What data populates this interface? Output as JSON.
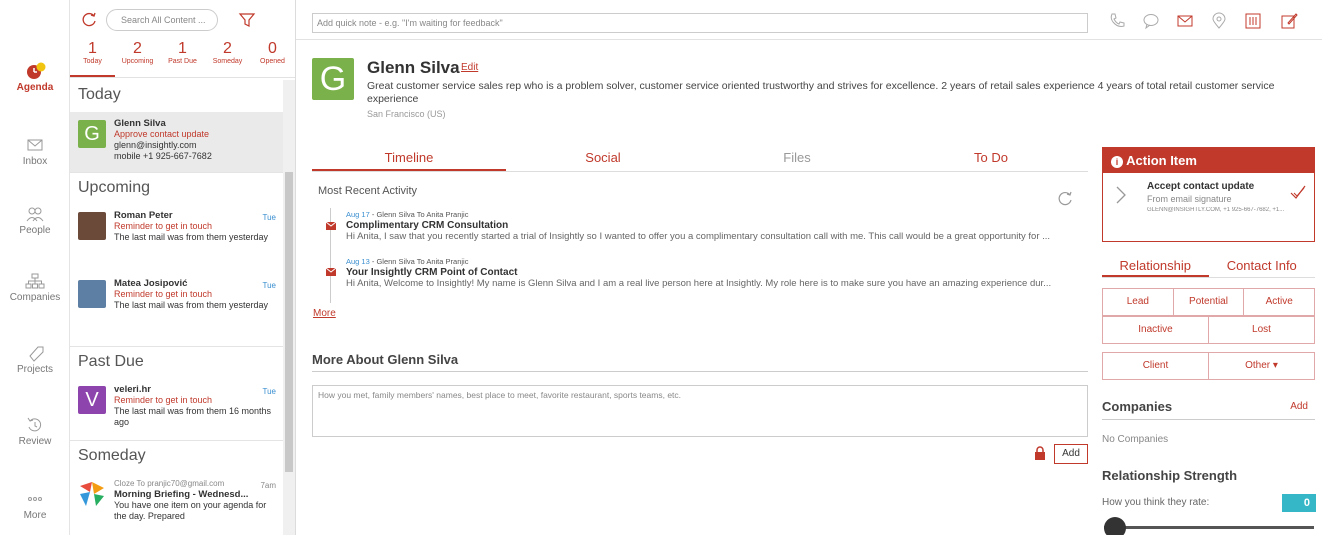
{
  "nav": {
    "items": [
      {
        "label": "Agenda",
        "badge": "1"
      },
      {
        "label": "Inbox"
      },
      {
        "label": "People"
      },
      {
        "label": "Companies"
      },
      {
        "label": "Projects"
      },
      {
        "label": "Review"
      },
      {
        "label": "More"
      }
    ]
  },
  "agenda": {
    "search_placeholder": "Search All Content ...",
    "counts": [
      {
        "n": "1",
        "label": "Today"
      },
      {
        "n": "2",
        "label": "Upcoming"
      },
      {
        "n": "1",
        "label": "Past Due"
      },
      {
        "n": "2",
        "label": "Someday"
      },
      {
        "n": "0",
        "label": "Opened"
      }
    ],
    "sections": {
      "today": "Today",
      "upcoming": "Upcoming",
      "pastdue": "Past Due",
      "someday": "Someday"
    },
    "today_item": {
      "avatar": "G",
      "name": "Glenn Silva",
      "action": "Approve contact update",
      "email": "glenn@insightly.com",
      "phone": "mobile +1 925-667-7682"
    },
    "upcoming_items": [
      {
        "name": "Roman Peter",
        "day": "Tue",
        "action": "Reminder to get in touch",
        "note": "The last mail was from them yesterday"
      },
      {
        "name": "Matea Josipović",
        "day": "Tue",
        "action": "Reminder to get in touch",
        "note": "The last mail was from them yesterday"
      }
    ],
    "pastdue_item": {
      "avatar": "V",
      "name": "veleri.hr",
      "day": "Tue",
      "action": "Reminder to get in touch",
      "note": "The last mail was from them 16 months ago"
    },
    "someday_item": {
      "meta": "Cloze To pranjic70@gmail.com",
      "time": "7am",
      "title": "Morning Briefing - Wednesd...",
      "note": "You have one item on your agenda for the day. Prepared"
    }
  },
  "topbar": {
    "note_placeholder": "Add quick note - e.g. \"I'm waiting for feedback\""
  },
  "contact": {
    "avatar": "G",
    "name": "Glenn Silva",
    "edit": "Edit",
    "description": "Great customer service sales rep who is a problem solver, customer service oriented trustworthy and strives for excellence. 2 years of retail sales experience 4 years of total retail customer service experience",
    "location": "San Francisco (US)"
  },
  "tabs": [
    "Timeline",
    "Social",
    "Files",
    "To Do"
  ],
  "timeline": {
    "heading": "Most Recent Activity",
    "activities": [
      {
        "date": "Aug 17",
        "meta": " - Glenn Silva  To Anita Pranjic",
        "title": "Complimentary CRM Consultation",
        "body": "Hi Anita, I saw that you recently started a trial of Insightly so I wanted to offer you a complimentary consultation call with me. This call would be a great opportunity for ..."
      },
      {
        "date": "Aug 13",
        "meta": " - Glenn Silva  To Anita Pranjic",
        "title": "Your Insightly CRM Point of Contact",
        "body": "Hi Anita, Welcome to Insightly!  My name is Glenn Silva and I am a real live person here at Insightly.  My role here is to make sure you have an amazing experience dur..."
      }
    ],
    "more": "More"
  },
  "more_about": {
    "heading": "More About Glenn Silva",
    "placeholder": "How you met, family members' names, best place to meet, favorite restaurant, sports teams, etc.",
    "add": "Add"
  },
  "action_item": {
    "header": "Action Item",
    "title": "Accept contact update",
    "subtitle": "From email signature",
    "detail": "GLENN@INSIGHTLY.COM, +1 925-667-7682, +1..."
  },
  "relationship": {
    "tabs": [
      "Relationship",
      "Contact Info"
    ],
    "stages_row1": [
      "Lead",
      "Potential",
      "Active"
    ],
    "stages_row2": [
      "Inactive",
      "Lost"
    ],
    "stages_row3": [
      "Client",
      "Other ▾"
    ]
  },
  "companies": {
    "heading": "Companies",
    "add": "Add",
    "empty": "No Companies"
  },
  "strength": {
    "heading": "Relationship Strength",
    "prompt": "How you think they rate:",
    "value": "0"
  },
  "colors": {
    "accent": "#c0392b",
    "contact_avatar": "#7bb14a",
    "pastdue_avatar": "#8e44ad",
    "badge": "#35b7c7"
  }
}
